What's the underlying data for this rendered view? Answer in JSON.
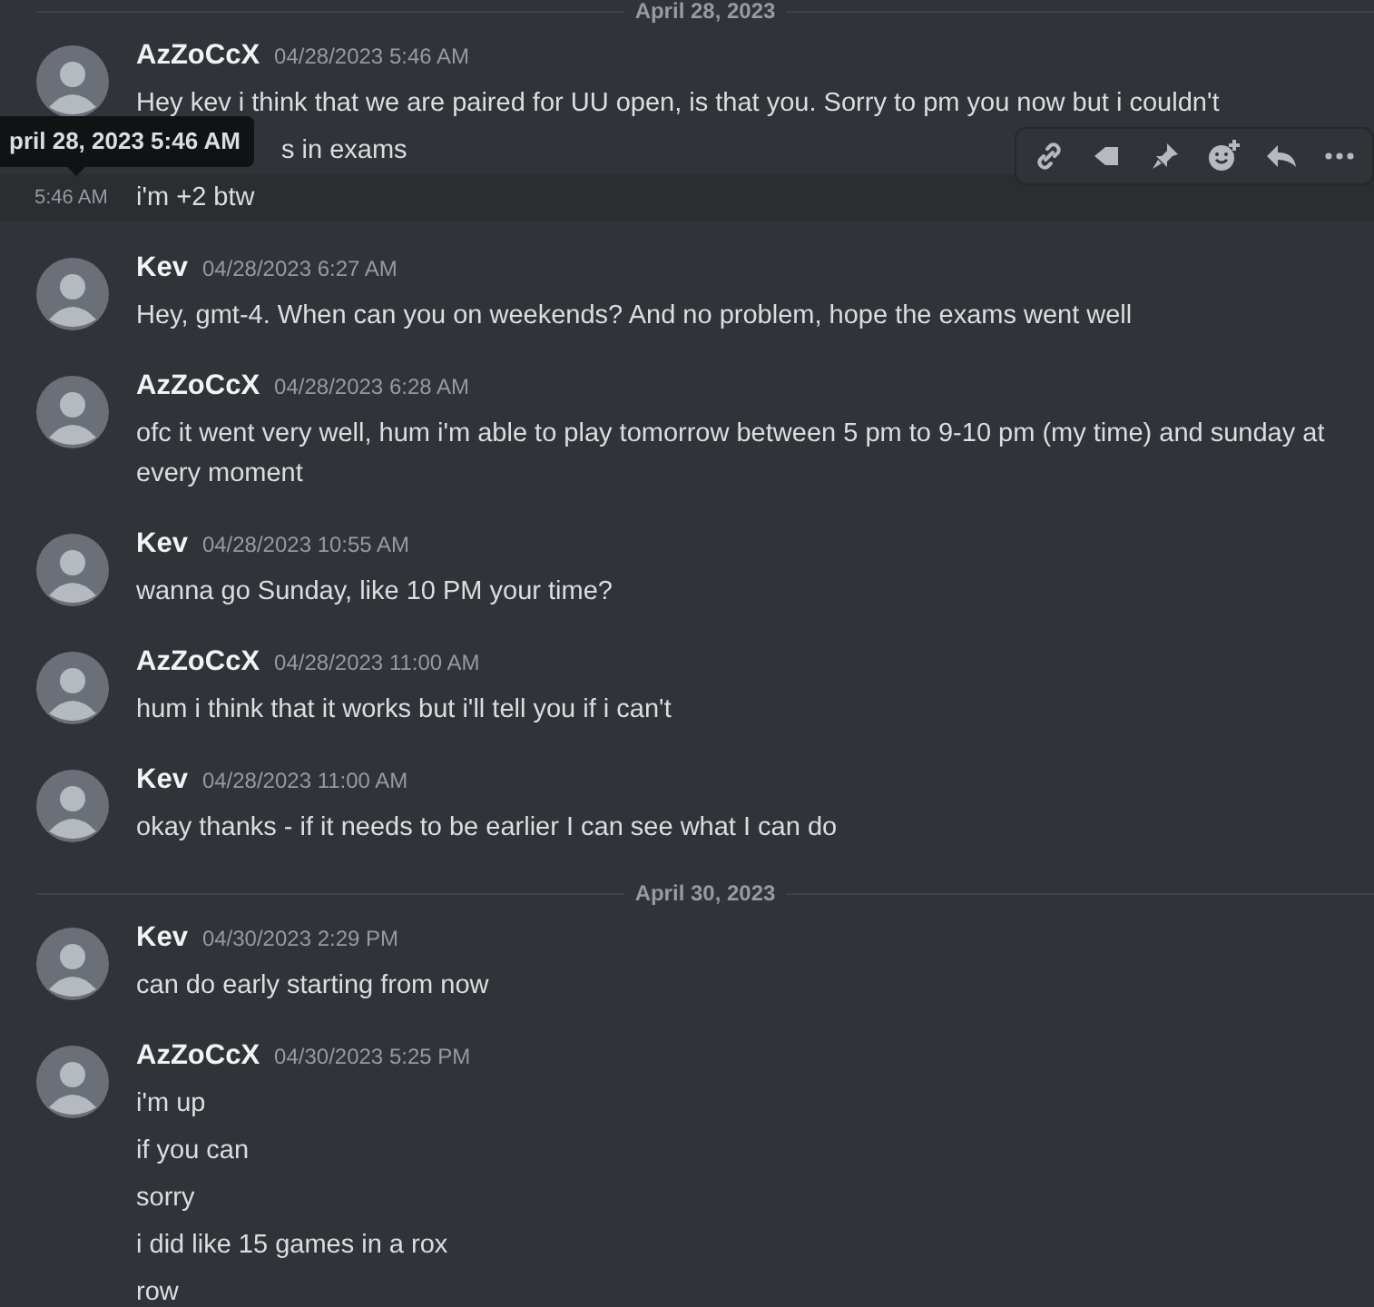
{
  "tooltip": "pril 28, 2023 5:46 AM",
  "feed": [
    {
      "kind": "divider",
      "label": "April 28, 2023"
    },
    {
      "kind": "group",
      "author": "AzZoCcX",
      "time": "04/28/2023 5:46 AM",
      "lines": [
        {
          "text": "Hey kev i think that we are paired for UU open, is that you. Sorry to pm you now but i couldn't"
        },
        {
          "text": "s in exams",
          "under_tooltip": true
        },
        {
          "text": "i'm +2 btw",
          "hovered": true,
          "hover_time": "5:46 AM"
        }
      ]
    },
    {
      "kind": "group",
      "author": "Kev",
      "time": "04/28/2023 6:27 AM",
      "lines": [
        {
          "text": "Hey, gmt-4. When can you on weekends? And no problem, hope the exams went well"
        }
      ]
    },
    {
      "kind": "group",
      "author": "AzZoCcX",
      "time": "04/28/2023 6:28 AM",
      "lines": [
        {
          "text": "ofc it went very well, hum i'm able to play tomorrow between 5 pm to 9-10 pm (my time) and sunday at every moment"
        }
      ]
    },
    {
      "kind": "group",
      "author": "Kev",
      "time": "04/28/2023 10:55 AM",
      "lines": [
        {
          "text": "wanna go Sunday, like 10 PM your time?"
        }
      ]
    },
    {
      "kind": "group",
      "author": "AzZoCcX",
      "time": "04/28/2023 11:00 AM",
      "lines": [
        {
          "text": "hum i think that it works but i'll tell you if i can't"
        }
      ]
    },
    {
      "kind": "group",
      "author": "Kev",
      "time": "04/28/2023 11:00 AM",
      "lines": [
        {
          "text": "okay thanks - if it needs to be earlier I can see what I can do"
        }
      ]
    },
    {
      "kind": "divider",
      "label": "April 30, 2023"
    },
    {
      "kind": "group",
      "author": "Kev",
      "time": "04/30/2023 2:29 PM",
      "lines": [
        {
          "text": "can do early starting from now"
        }
      ]
    },
    {
      "kind": "group",
      "author": "AzZoCcX",
      "time": "04/30/2023 5:25 PM",
      "lines": [
        {
          "text": "i'm up"
        },
        {
          "text": "if you can"
        },
        {
          "text": "sorry"
        },
        {
          "text": "i did like 15 games in a rox"
        },
        {
          "text": "row"
        }
      ]
    }
  ]
}
